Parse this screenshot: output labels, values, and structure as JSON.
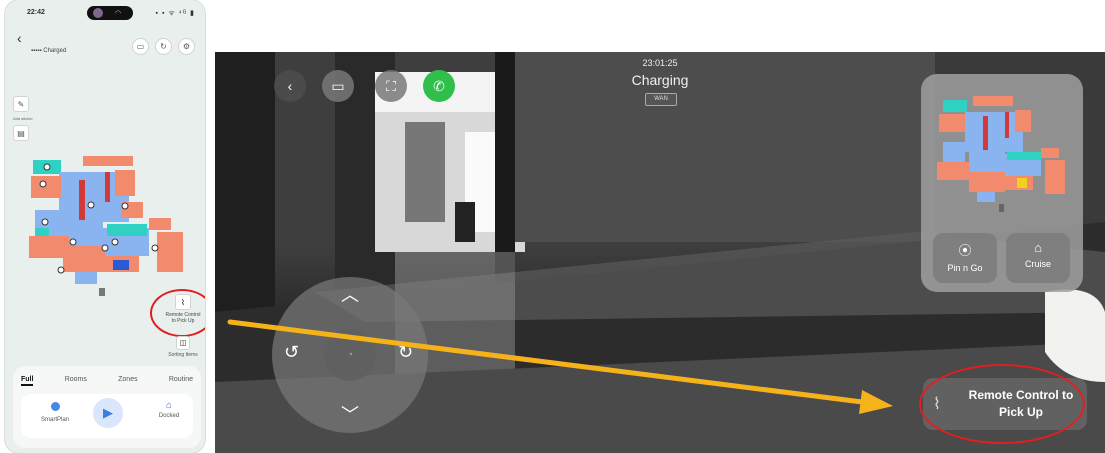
{
  "phone": {
    "status_time": "22:42",
    "status_icons": "▪ ▪ ᯤ ⁴ᴳ ▮",
    "device_status": "▪▪▪▪▪  Charged",
    "tools": {
      "small_label": "Add sticker"
    },
    "rc_label": "Remote Control to Pick Up",
    "sorting_label": "Sorting Items",
    "tabs": [
      "Full",
      "Rooms",
      "Zones",
      "Routine"
    ],
    "smartplan_label": "SmartPlan",
    "docked_label": "Docked",
    "icons": [
      "back-chevron-icon",
      "camera-icon",
      "refresh-icon",
      "settings-icon",
      "play-icon",
      "home-icon"
    ]
  },
  "camera": {
    "timestamp": "23:01:25",
    "status": "Charging",
    "network": "WAN",
    "pin_label": "Pin n Go",
    "cruise_label": "Cruise",
    "rc_label": "Remote Control to Pick Up",
    "call_color": "#2fbf4a",
    "arrow_color": "#f5b21a",
    "highlight_color": "#e02020"
  }
}
